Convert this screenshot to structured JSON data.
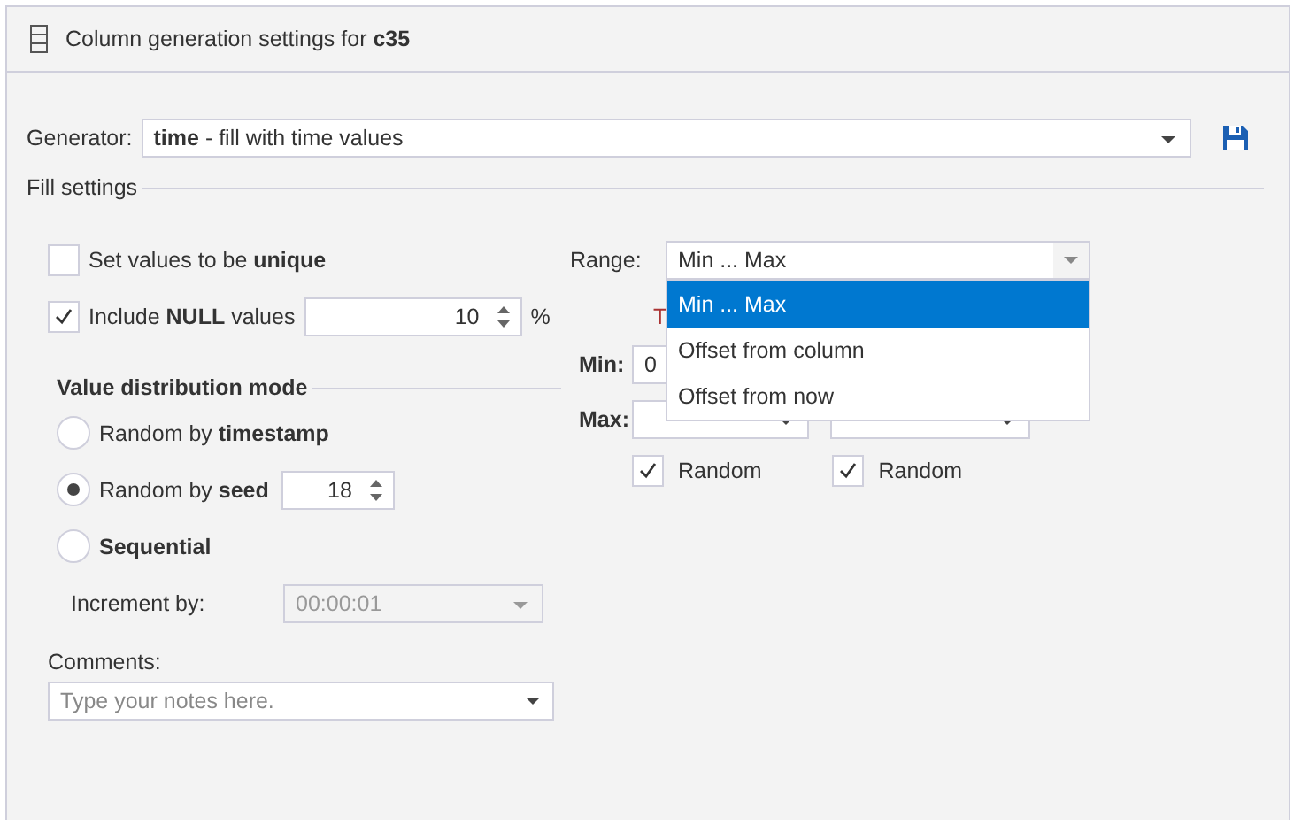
{
  "header": {
    "title": "Column generation settings for **c35**"
  },
  "generator": {
    "label": "Generator:",
    "value": "**time** - fill with time values"
  },
  "fill_settings": {
    "title": "Fill settings",
    "unique": {
      "label": "Set values to be **unique**",
      "checked": false
    },
    "include_null": {
      "label": "Include **NULL** values",
      "checked": true,
      "value": "10",
      "unit": "%"
    },
    "distribution": {
      "title": "Value distribution mode",
      "options": [
        {
          "label": "Random by **timestamp**",
          "selected": false
        },
        {
          "label": "Random by **seed**",
          "selected": true,
          "value": "18"
        },
        {
          "label": "**Sequential**",
          "selected": false
        }
      ]
    },
    "increment": {
      "label": "Increment by:",
      "value": "00:00:01",
      "disabled": true
    },
    "comments": {
      "label": "Comments:",
      "placeholder": "Type your notes here."
    },
    "range": {
      "label": "Range:",
      "value": "Min ... Max",
      "expanded": true,
      "options": [
        {
          "label": "Min ... Max",
          "selected": true
        },
        {
          "label": "Offset from column",
          "selected": false
        },
        {
          "label": "Offset from now",
          "selected": false
        }
      ]
    },
    "column_heading": "T",
    "min": {
      "label": "Min:",
      "value": "0"
    },
    "max": {
      "label": "Max:"
    },
    "random": [
      {
        "label": "Random",
        "checked": true
      },
      {
        "label": "Random",
        "checked": true
      }
    ]
  }
}
